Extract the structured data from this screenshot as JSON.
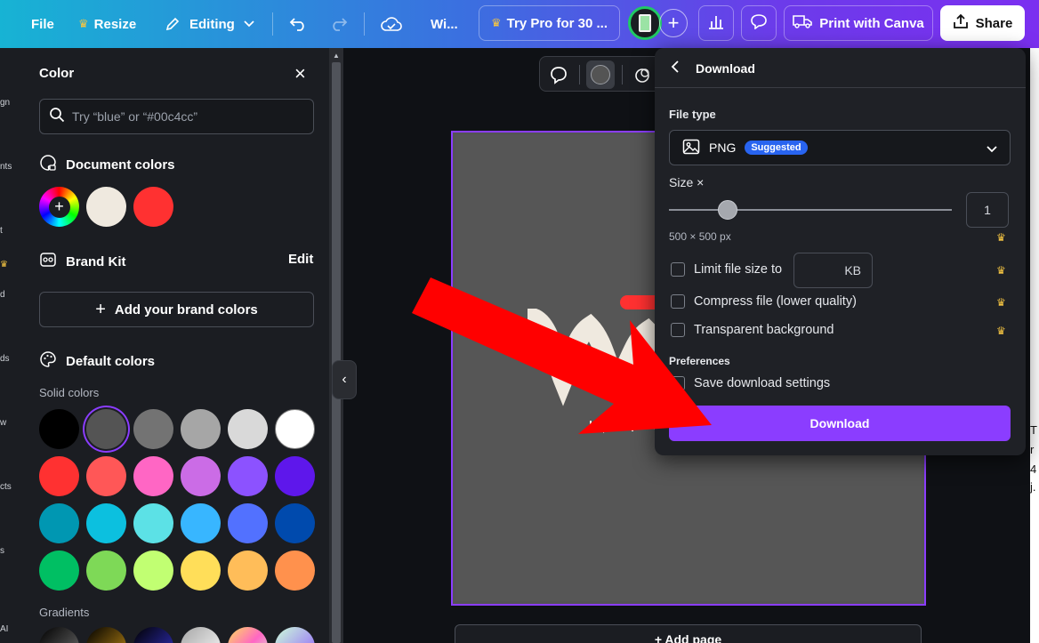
{
  "topbar": {
    "file": "File",
    "resize": "Resize",
    "editing": "Editing",
    "doc_title": "Wi...",
    "try_pro": "Try Pro for 30 ...",
    "print": "Print with Canva",
    "share": "Share"
  },
  "rail": {
    "labels": [
      "gn",
      "nts",
      "t",
      "d",
      "ds",
      "w",
      "cts",
      "s",
      "AI"
    ]
  },
  "color_panel": {
    "title": "Color",
    "search_placeholder": "Try “blue” or “#00c4cc”",
    "document_colors": "Document colors",
    "document_swatches": [
      "#efe9df",
      "#ff3131"
    ],
    "brand_kit": "Brand Kit",
    "edit": "Edit",
    "add_brand_colors": "Add your brand colors",
    "default_colors": "Default colors",
    "solid_colors": "Solid colors",
    "solid_swatches": [
      [
        "#000000",
        "#545454",
        "#737373",
        "#a6a6a6",
        "#d9d9d9",
        "#ffffff"
      ],
      [
        "#ff3131",
        "#ff5757",
        "#ff66c4",
        "#cb6ce6",
        "#8c52ff",
        "#5e17eb"
      ],
      [
        "#0097b2",
        "#0cc0df",
        "#5ce1e6",
        "#38b6ff",
        "#5271ff",
        "#004aad"
      ],
      [
        "#00bf63",
        "#7ed957",
        "#c1ff72",
        "#ffde59",
        "#ffbd59",
        "#ff914d"
      ]
    ],
    "gradients": "Gradients"
  },
  "canvas": {
    "add_page": "+ Add page"
  },
  "download": {
    "title": "Download",
    "file_type_label": "File type",
    "file_type": "PNG",
    "suggested": "Suggested",
    "size_label": "Size ×",
    "size_value": "1",
    "size_fraction": 0.19,
    "dimensions": "500 × 500 px",
    "limit_file_size": "Limit file size to",
    "kb": "KB",
    "compress": "Compress file (lower quality)",
    "transparent": "Transparent background",
    "preferences": "Preferences",
    "save_settings": "Save download settings",
    "download_button": "Download"
  },
  "side_text": [
    "T",
    "r",
    "4",
    "j."
  ],
  "colors": {
    "accent": "#8b3dff",
    "arrow": "#ff0000",
    "crown": "#f5c542"
  }
}
